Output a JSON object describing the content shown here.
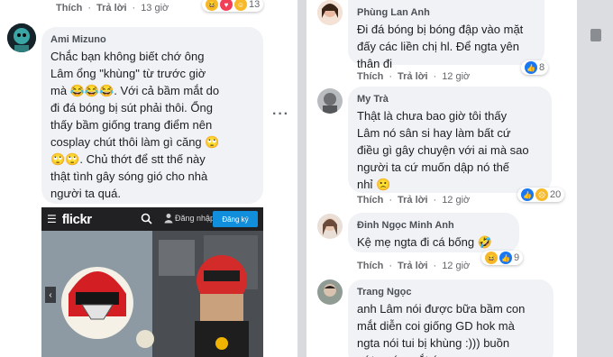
{
  "left": {
    "top_actions": {
      "like": "Thích",
      "reply": "Trả lời",
      "time": "13 giờ",
      "reaction_count": "13"
    },
    "comment": {
      "author": "Ami Mizuno",
      "text": "Chắc bạn không biết chớ ông\nLâm ổng \"khùng\" từ trước giờ\nmà 😂😂😂. Với cả bầm mắt do\nđi đá bóng bị sút phải thôi. Ổng\nthấy bầm giống trang điểm nên\ncosplay chút thôi làm gì căng 🙄\n🙄🙄. Chủ thớt để stt thế này\nthật tình gây sóng gió cho nhà\nngười ta quá."
    },
    "more_icon": "more-dots-icon",
    "flickr": {
      "logo": "flickr",
      "login": "Đăng nhập",
      "signup": "Đăng ký",
      "search_icon": "search-icon",
      "menu_icon": "menu-icon"
    }
  },
  "right": {
    "comments": [
      {
        "author": "Phùng Lan Anh",
        "text": "Đi đá bóng bị bóng đập vào mặt\nđấy các liền chị hl. Để ngta yên\nthân đi",
        "like": "Thích",
        "reply": "Trả lời",
        "time": "12 giờ",
        "reaction_count": "8"
      },
      {
        "author": "My Trà",
        "text": "Thật là chưa bao giờ tôi thấy\nLâm nó sân si hay làm bất cứ\nđiều gì gây chuyện với ai mà sao\nngười ta cứ muốn dập nó thế\nnhỉ 🙁",
        "like": "Thích",
        "reply": "Trả lời",
        "time": "12 giờ",
        "reaction_count": "20"
      },
      {
        "author": "Đinh Ngọc Minh Anh",
        "text": "Kệ mẹ ngta đi cá bống 🤣",
        "like": "Thích",
        "reply": "Trả lời",
        "time": "12 giờ",
        "reaction_count": "9"
      },
      {
        "author": "Trang Ngọc",
        "text": "anh Lâm nói được bữa bầm con\nmắt diễn coi giống GD hok mà\nngta nói tui bị khùng :))) buồn\ngớt nước mắt á"
      }
    ]
  },
  "colors": {
    "like_blue": "#1877f2",
    "haha_yellow": "#f7b928",
    "love_red": "#f33e58",
    "bubble": "#f0f2f5",
    "flickr_blue": "#128fdc"
  }
}
